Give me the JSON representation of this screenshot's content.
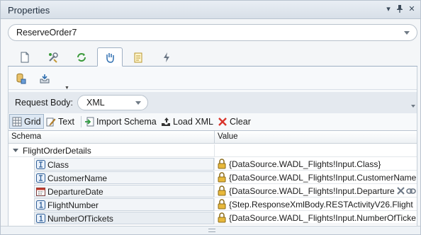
{
  "window": {
    "title": "Properties",
    "controls": [
      "menu-arrow",
      "pin",
      "close"
    ]
  },
  "object_selector": {
    "value": "ReserveOrder7"
  },
  "tabs": [
    {
      "icon": "document-icon",
      "active": false
    },
    {
      "icon": "tools-icon",
      "active": false
    },
    {
      "icon": "refresh-arrow-icon",
      "active": false
    },
    {
      "icon": "hand-icon",
      "active": true
    },
    {
      "icon": "notes-icon",
      "active": false
    },
    {
      "icon": "lightning-icon",
      "active": false
    }
  ],
  "icon_toolbar": [
    {
      "icon": "database-link-icon"
    },
    {
      "icon": "inbox-download-icon"
    }
  ],
  "request_body": {
    "label": "Request Body:",
    "value": "XML"
  },
  "toolbar": {
    "grid": "Grid",
    "text": "Text",
    "import_schema": "Import Schema",
    "load_xml": "Load XML",
    "clear": "Clear"
  },
  "grid": {
    "columns": {
      "schema": "Schema",
      "value": "Value"
    },
    "root": {
      "name": "FlightOrderDetails",
      "expanded": true
    },
    "rows": [
      {
        "name": "Class",
        "type_icon": "text-type-icon",
        "value": "{DataSource.WADL_Flights!Input.Class}",
        "locked": true
      },
      {
        "name": "CustomerName",
        "type_icon": "text-type-icon",
        "value": "{DataSource.WADL_Flights!Input.CustomerName",
        "locked": true
      },
      {
        "name": "DepartureDate",
        "type_icon": "calendar-type-icon",
        "value": "{DataSource.WADL_Flights!Input.Departure",
        "locked": true
      },
      {
        "name": "FlightNumber",
        "type_icon": "number-type-icon",
        "value": "{Step.ResponseXmlBody.RESTActivityV26.Flight",
        "locked": true
      },
      {
        "name": "NumberOfTickets",
        "type_icon": "number-type-icon",
        "value": "{DataSource.WADL_Flights!Input.NumberOfTicke",
        "locked": true
      }
    ]
  }
}
